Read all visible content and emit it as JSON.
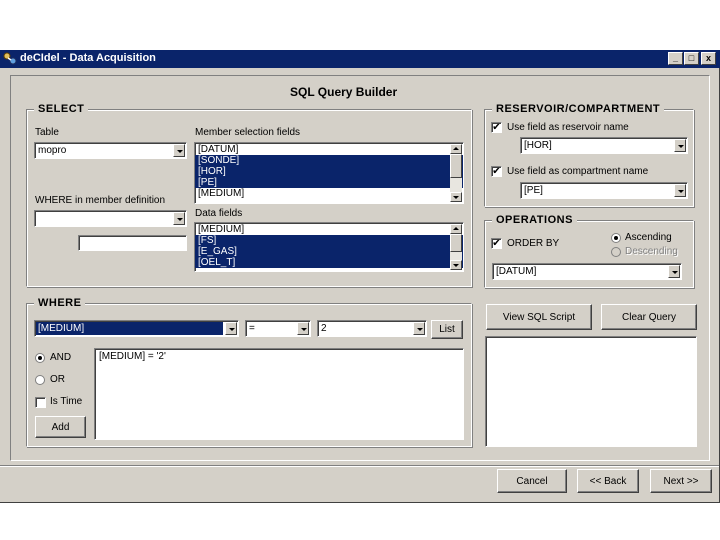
{
  "window": {
    "title": "deCIdel - Data Acquisition",
    "min": "_",
    "max": "□",
    "close": "x"
  },
  "heading": "SQL Query Builder",
  "select": {
    "legend": "SELECT",
    "table_label": "Table",
    "table_value": "mopro",
    "where_member_label": "WHERE in member definition",
    "where_member_value": "",
    "member_text_value": "",
    "member_fields_label": "Member selection fields",
    "member_fields": [
      "[DATUM]",
      "[SONDE]",
      "[HOR]",
      "[PE]",
      "[MEDIUM]"
    ],
    "data_fields_label": "Data fields",
    "data_fields": [
      "[MEDIUM]",
      "[FS]",
      "[E_GAS]",
      "[OEL_T]"
    ]
  },
  "reservoir": {
    "legend": "RESERVOIR/COMPARTMENT",
    "use_reservoir_label": "Use field as reservoir name",
    "use_reservoir_checked": "✔",
    "reservoir_value": "[HOR]",
    "use_compartment_label": "Use field as compartment name",
    "use_compartment_checked": "✔",
    "compartment_value": "[PE]"
  },
  "operations": {
    "legend": "OPERATIONS",
    "order_by_label": "ORDER BY",
    "order_by_checked": "✔",
    "ascending_label": "Ascending",
    "descending_label": "Descending",
    "order_field": "[DATUM]"
  },
  "where": {
    "legend": "WHERE",
    "field_value": "[MEDIUM]",
    "operator_value": "=",
    "value_value": "2",
    "list_button": "List",
    "and_label": "AND",
    "or_label": "OR",
    "is_time_label": "Is Time",
    "add_button": "Add",
    "clause_text": "[MEDIUM] = '2'"
  },
  "buttons": {
    "view_sql": "View SQL Script",
    "clear_query": "Clear Query",
    "cancel": "Cancel",
    "back": "<< Back",
    "next": "Next >>"
  },
  "colors": {
    "titlebar": "#0a246a",
    "selection": "#0a246a",
    "face": "#d4d0c8"
  }
}
